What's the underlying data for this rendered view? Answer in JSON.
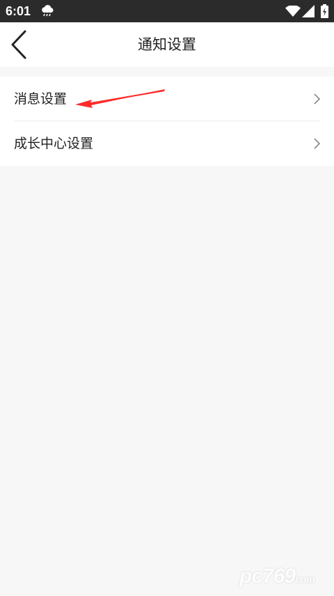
{
  "status_bar": {
    "time": "6:01",
    "icons": [
      "weather-icon",
      "wifi-icon",
      "signal-icon",
      "battery-icon"
    ]
  },
  "header": {
    "title": "通知设置",
    "back_icon": "chevron-left-icon"
  },
  "settings": {
    "items": [
      {
        "label": "消息设置",
        "icon": "chevron-right-icon"
      },
      {
        "label": "成长中心设置",
        "icon": "chevron-right-icon"
      }
    ]
  },
  "annotation": {
    "type": "red-arrow",
    "color": "#ff2a2a"
  },
  "watermark": {
    "text": "pc769",
    "suffix": "com"
  },
  "colors": {
    "status_bar": "#2b2b2b",
    "page_background": "#f7f7f7",
    "row_background": "#ffffff",
    "title_text": "#222222",
    "chevron": "#888888"
  }
}
